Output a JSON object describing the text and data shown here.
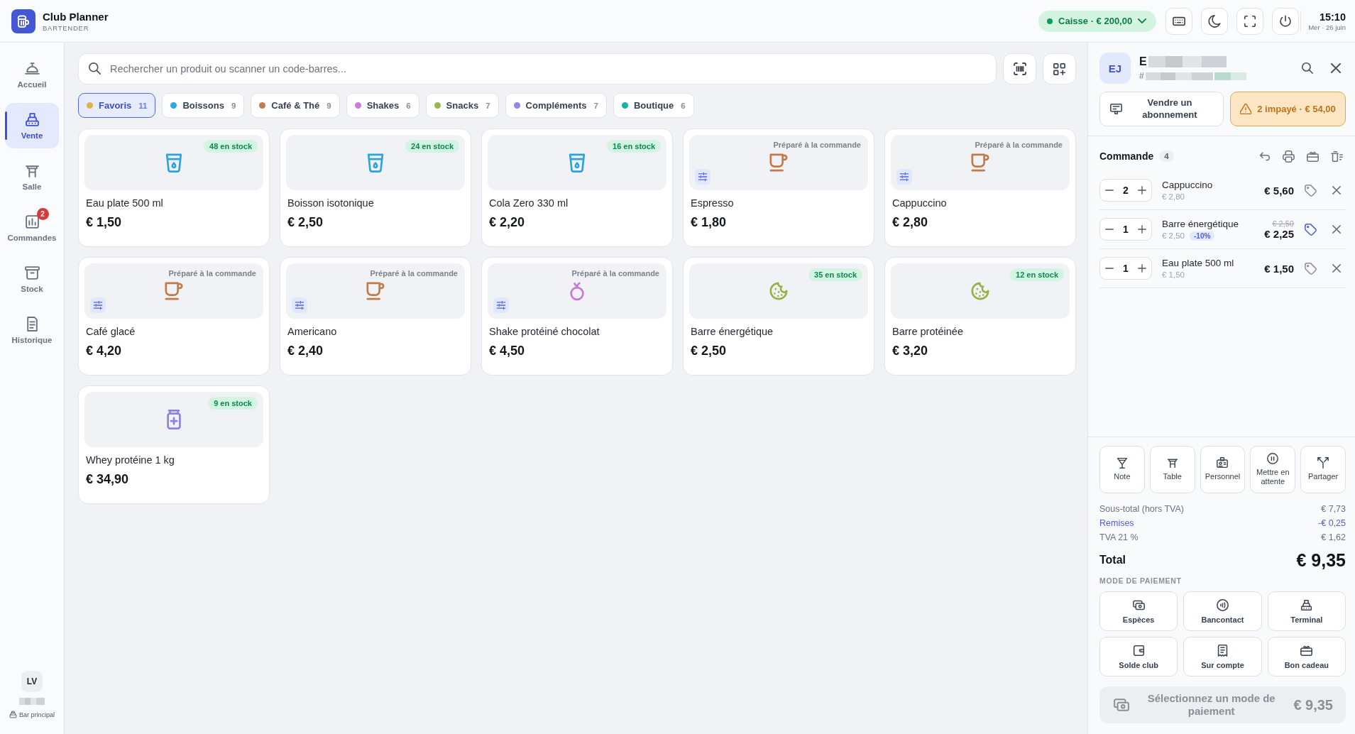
{
  "header": {
    "app_name": "Club Planner",
    "role": "BARTENDER",
    "register": "Caisse · € 200,00",
    "time": "15:10",
    "date": "Mer · 26 juin"
  },
  "sidebar": {
    "items": [
      {
        "label": "Accueil",
        "selected": false
      },
      {
        "label": "Vente",
        "selected": true
      },
      {
        "label": "Salle",
        "selected": false
      },
      {
        "label": "Commandes",
        "selected": false,
        "badge": "2"
      },
      {
        "label": "Stock",
        "selected": false
      },
      {
        "label": "Historique",
        "selected": false
      }
    ],
    "user": {
      "initials": "LV",
      "location": "Bar principal"
    }
  },
  "search": {
    "placeholder": "Rechercher un produit ou scanner un code-barres..."
  },
  "categories": [
    {
      "label": "Favoris",
      "count": "11",
      "color": "#d8b64c",
      "selected": true
    },
    {
      "label": "Boissons",
      "count": "9",
      "color": "#2ea8e0",
      "selected": false
    },
    {
      "label": "Café & Thé",
      "count": "9",
      "color": "#c27c4e",
      "selected": false
    },
    {
      "label": "Shakes",
      "count": "6",
      "color": "#c77ed8",
      "selected": false
    },
    {
      "label": "Snacks",
      "count": "7",
      "color": "#9ab84a",
      "selected": false
    },
    {
      "label": "Compléments",
      "count": "7",
      "color": "#8c86e6",
      "selected": false
    },
    {
      "label": "Boutique",
      "count": "6",
      "color": "#19b3a4",
      "selected": false
    }
  ],
  "products": [
    {
      "name": "Eau plate 500 ml",
      "price": "€ 1,50",
      "kind": "drink",
      "badge": {
        "kind": "stock",
        "text": "48 en stock"
      },
      "options": false
    },
    {
      "name": "Boisson isotonique",
      "price": "€ 2,50",
      "kind": "drink",
      "badge": {
        "kind": "stock",
        "text": "24 en stock"
      },
      "options": false
    },
    {
      "name": "Cola Zero 330 ml",
      "price": "€ 2,20",
      "kind": "drink",
      "badge": {
        "kind": "stock",
        "text": "16 en stock"
      },
      "options": false
    },
    {
      "name": "Espresso",
      "price": "€ 1,80",
      "kind": "coffee",
      "badge": {
        "kind": "made_to_order",
        "text": "Préparé à la commande"
      },
      "options": true
    },
    {
      "name": "Cappuccino",
      "price": "€ 2,80",
      "kind": "coffee",
      "badge": {
        "kind": "made_to_order",
        "text": "Préparé à la commande"
      },
      "options": true
    },
    {
      "name": "Café glacé",
      "price": "€ 4,20",
      "kind": "coffee",
      "badge": {
        "kind": "made_to_order",
        "text": "Préparé à la commande"
      },
      "options": true
    },
    {
      "name": "Americano",
      "price": "€ 2,40",
      "kind": "coffee",
      "badge": {
        "kind": "made_to_order",
        "text": "Préparé à la commande"
      },
      "options": true
    },
    {
      "name": "Shake protéiné chocolat",
      "price": "€ 4,50",
      "kind": "shake",
      "badge": {
        "kind": "made_to_order",
        "text": "Préparé à la commande"
      },
      "options": true
    },
    {
      "name": "Barre énergétique",
      "price": "€ 2,50",
      "kind": "snack",
      "badge": {
        "kind": "stock",
        "text": "35 en stock"
      },
      "options": false
    },
    {
      "name": "Barre protéinée",
      "price": "€ 3,20",
      "kind": "snack",
      "badge": {
        "kind": "stock",
        "text": "12 en stock"
      },
      "options": false
    },
    {
      "name": "Whey protéine 1 kg",
      "price": "€ 34,90",
      "kind": "supplement",
      "badge": {
        "kind": "stock",
        "text": "9 en stock"
      },
      "options": false
    }
  ],
  "customer": {
    "initials": "EJ",
    "name": "E",
    "number": "#",
    "subscription_action": "Vendre un abonnement",
    "unpaid": "2 impayé · € 54,00"
  },
  "order": {
    "title": "Commande",
    "count": "4",
    "items": [
      {
        "quantity": "2",
        "name": "Cappuccino",
        "unit_price": "€ 2,80",
        "total": "€ 5,60",
        "discounted": false
      },
      {
        "quantity": "1",
        "name": "Barre énergétique",
        "unit_price": "€ 2,50",
        "discount": "-10%",
        "original_total": "€ 2,50",
        "total": "€ 2,25",
        "discounted": true
      },
      {
        "quantity": "1",
        "name": "Eau plate 500 ml",
        "unit_price": "€ 1,50",
        "total": "€ 1,50",
        "discounted": false
      }
    ]
  },
  "order_actions": [
    {
      "label": "Note"
    },
    {
      "label": "Table"
    },
    {
      "label": "Personnel"
    },
    {
      "label": "Mettre en attente"
    },
    {
      "label": "Partager"
    }
  ],
  "summary": {
    "rows": [
      {
        "label": "Sous-total (hors TVA)",
        "value": "€ 7,73",
        "kind": "amount"
      },
      {
        "label": "Remises",
        "value": "-€ 0,25",
        "kind": "discount"
      },
      {
        "label": "TVA 21 %",
        "value": "€ 1,62",
        "kind": "amount"
      }
    ],
    "total": {
      "label": "Total",
      "value": "€ 9,35"
    }
  },
  "payment": {
    "title": "MODE DE PAIEMENT",
    "methods": [
      {
        "label": "Espèces",
        "selected": false
      },
      {
        "label": "Bancontact",
        "selected": false
      },
      {
        "label": "Terminal",
        "selected": false
      },
      {
        "label": "Solde club",
        "selected": false
      },
      {
        "label": "Sur compte",
        "selected": false
      },
      {
        "label": "Bon cadeau",
        "selected": false
      }
    ],
    "submit": {
      "label": "Sélectionnez un mode de paiement",
      "amount": "€ 9,35",
      "disabled": true
    }
  }
}
